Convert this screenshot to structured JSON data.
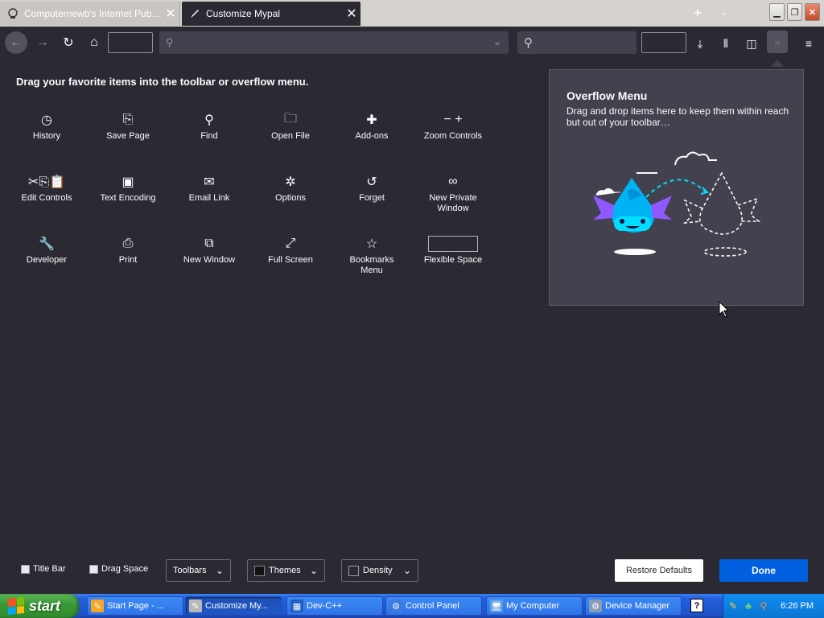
{
  "tabs": [
    {
      "label": "Computernewb's Internet Pub Hub",
      "icon": "pub-hub-icon",
      "active": false
    },
    {
      "label": "Customize Mypal",
      "icon": "paintbrush-icon",
      "active": true
    }
  ],
  "heading": "Drag your favorite items into the toolbar or overflow menu.",
  "palette": [
    {
      "label": "History",
      "icon": "clock-icon",
      "glyph": "◷"
    },
    {
      "label": "Save Page",
      "icon": "save-page-icon",
      "glyph": "⎘"
    },
    {
      "label": "Find",
      "icon": "magnifier-icon",
      "glyph": "⚲"
    },
    {
      "label": "Open File",
      "icon": "open-file-icon",
      "glyph": "🗀"
    },
    {
      "label": "Add-ons",
      "icon": "puzzle-icon",
      "glyph": "✚"
    },
    {
      "label": "Zoom Controls",
      "icon": "zoom-icon",
      "glyph": "− +"
    },
    {
      "label": "Edit Controls",
      "icon": "edit-controls-icon",
      "glyph": "✂⎘📋"
    },
    {
      "label": "Text Encoding",
      "icon": "text-encoding-icon",
      "glyph": "▣"
    },
    {
      "label": "Email Link",
      "icon": "envelope-icon",
      "glyph": "✉"
    },
    {
      "label": "Options",
      "icon": "gear-icon",
      "glyph": "✲"
    },
    {
      "label": "Forget",
      "icon": "forget-icon",
      "glyph": "↺"
    },
    {
      "label": "New Private\nWindow",
      "icon": "mask-icon",
      "glyph": "∞"
    },
    {
      "label": "Developer",
      "icon": "wrench-icon",
      "glyph": "🔧"
    },
    {
      "label": "Print",
      "icon": "printer-icon",
      "glyph": "⎙"
    },
    {
      "label": "New Window",
      "icon": "new-window-icon",
      "glyph": "⧉"
    },
    {
      "label": "Full Screen",
      "icon": "fullscreen-icon",
      "glyph": "⤢"
    },
    {
      "label": "Bookmarks\nMenu",
      "icon": "bookmark-star-icon",
      "glyph": "☆"
    },
    {
      "label": "Flexible Space",
      "icon": "flexible-space-box",
      "glyph": ""
    }
  ],
  "overflow_panel": {
    "title": "Overflow Menu",
    "description": "Drag and drop items here to keep them within reach but out of your toolbar…"
  },
  "bottom": {
    "title_bar_label": "Title Bar",
    "drag_space_label": "Drag Space",
    "toolbars_label": "Toolbars",
    "themes_label": "Themes",
    "density_label": "Density",
    "restore_label": "Restore Defaults",
    "done_label": "Done"
  },
  "taskbar": {
    "start_label": "start",
    "tasks": [
      {
        "label": "Start Page - ...",
        "icon": "ie-icon",
        "active": false
      },
      {
        "label": "Customize My...",
        "icon": "mypal-icon",
        "active": true
      },
      {
        "label": "Dev-C++",
        "icon": "devcpp-icon",
        "active": false
      },
      {
        "label": "Control Panel",
        "icon": "control-panel-icon",
        "active": false
      },
      {
        "label": "My Computer",
        "icon": "my-computer-icon",
        "active": false
      },
      {
        "label": "Device Manager",
        "icon": "device-manager-icon",
        "active": false
      }
    ],
    "help_glyph": "?",
    "clock": "6:26 PM"
  },
  "colors": {
    "background": "#2b2a33",
    "panel": "#42414d",
    "accent": "#0060df",
    "illustration_accent": "#00ddff"
  }
}
